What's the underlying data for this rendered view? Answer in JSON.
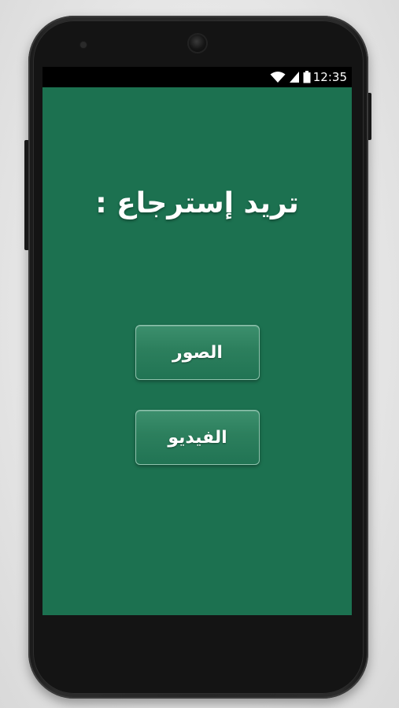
{
  "status_bar": {
    "time": "12:35",
    "icons": [
      "wifi-icon",
      "signal-icon",
      "battery-icon"
    ]
  },
  "main": {
    "question": "تريد إسترجاع :",
    "buttons": [
      {
        "label": "الصور"
      },
      {
        "label": "الفيديو"
      }
    ]
  },
  "colors": {
    "background": "#1c7150",
    "button": "#2c7f5d",
    "button_border": "#8ec3ad",
    "text": "#ffffff"
  }
}
